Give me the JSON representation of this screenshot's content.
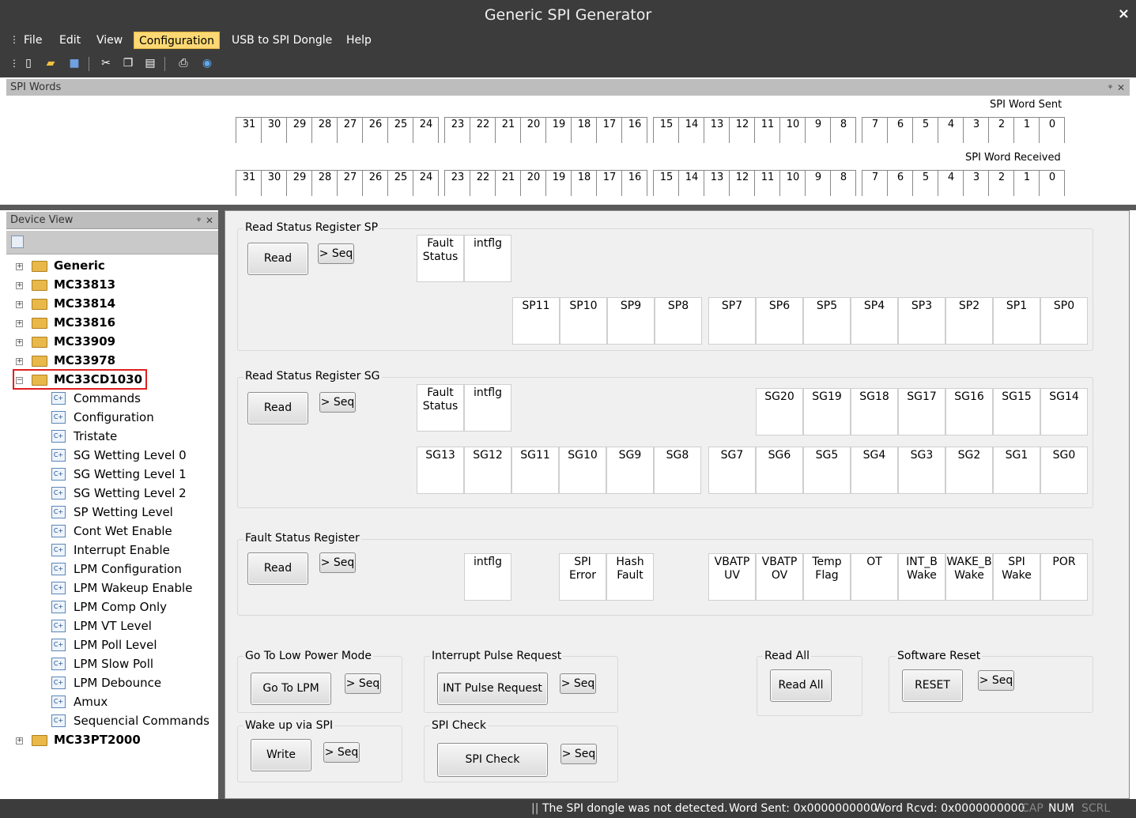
{
  "window": {
    "title": "Generic SPI Generator",
    "close_label": "×"
  },
  "menu": {
    "items": [
      "File",
      "Edit",
      "View",
      "Configuration",
      "USB to SPI Dongle",
      "Help"
    ],
    "active": "Configuration"
  },
  "toolbar": {
    "icons": [
      "new-icon",
      "open-icon",
      "save-icon",
      "cut-icon",
      "copy-icon",
      "paste-icon",
      "print-icon",
      "help-icon"
    ]
  },
  "spi_words": {
    "pane_title": "SPI Words",
    "sent_label": "SPI Word Sent",
    "received_label": "SPI Word Received",
    "bits": [
      "31",
      "30",
      "29",
      "28",
      "27",
      "26",
      "25",
      "24",
      "23",
      "22",
      "21",
      "20",
      "19",
      "18",
      "17",
      "16",
      "15",
      "14",
      "13",
      "12",
      "11",
      "10",
      "9",
      "8",
      "7",
      "6",
      "5",
      "4",
      "3",
      "2",
      "1",
      "0"
    ]
  },
  "device_view": {
    "pane_title": "Device View",
    "tree": [
      {
        "label": "Generic",
        "type": "folder",
        "expanded": false
      },
      {
        "label": "MC33813",
        "type": "folder",
        "expanded": false
      },
      {
        "label": "MC33814",
        "type": "folder",
        "expanded": false
      },
      {
        "label": "MC33816",
        "type": "folder",
        "expanded": false
      },
      {
        "label": "MC33909",
        "type": "folder",
        "expanded": false
      },
      {
        "label": "MC33978",
        "type": "folder",
        "expanded": false
      },
      {
        "label": "MC33CD1030",
        "type": "folder",
        "expanded": true,
        "highlighted": true
      },
      {
        "label": "Commands",
        "type": "leaf"
      },
      {
        "label": "Configuration",
        "type": "leaf"
      },
      {
        "label": "Tristate",
        "type": "leaf"
      },
      {
        "label": "SG Wetting Level 0",
        "type": "leaf"
      },
      {
        "label": "SG Wetting Level 1",
        "type": "leaf"
      },
      {
        "label": "SG Wetting Level 2",
        "type": "leaf"
      },
      {
        "label": "SP Wetting Level",
        "type": "leaf"
      },
      {
        "label": "Cont Wet Enable",
        "type": "leaf"
      },
      {
        "label": "Interrupt Enable",
        "type": "leaf"
      },
      {
        "label": "LPM Configuration",
        "type": "leaf"
      },
      {
        "label": "LPM Wakeup Enable",
        "type": "leaf"
      },
      {
        "label": "LPM Comp Only",
        "type": "leaf"
      },
      {
        "label": "LPM VT Level",
        "type": "leaf"
      },
      {
        "label": "LPM Poll Level",
        "type": "leaf"
      },
      {
        "label": "LPM Slow Poll",
        "type": "leaf"
      },
      {
        "label": "LPM Debounce",
        "type": "leaf"
      },
      {
        "label": "Amux",
        "type": "leaf"
      },
      {
        "label": "Sequencial Commands",
        "type": "leaf"
      },
      {
        "label": "MC33PT2000",
        "type": "folder",
        "expanded": false
      }
    ]
  },
  "main": {
    "seq_label": "> Seq",
    "read_label": "Read",
    "sp_group": {
      "title": "Read Status Register SP",
      "top_cells": [
        "Fault\nStatus",
        "intflg"
      ],
      "cells": [
        "SP11",
        "SP10",
        "SP9",
        "SP8",
        "SP7",
        "SP6",
        "SP5",
        "SP4",
        "SP3",
        "SP2",
        "SP1",
        "SP0"
      ]
    },
    "sg_group": {
      "title": "Read Status Register SG",
      "top_cells": [
        "Fault\nStatus",
        "intflg"
      ],
      "cells_row1": [
        "SG20",
        "SG19",
        "SG18",
        "SG17",
        "SG16",
        "SG15",
        "SG14"
      ],
      "cells_row2": [
        "SG13",
        "SG12",
        "SG11",
        "SG10",
        "SG9",
        "SG8",
        "SG7",
        "SG6",
        "SG5",
        "SG4",
        "SG3",
        "SG2",
        "SG1",
        "SG0"
      ]
    },
    "fault_group": {
      "title": "Fault Status Register",
      "cells": [
        "intflg",
        "SPI\nError",
        "Hash\nFault",
        "VBATP\nUV",
        "VBATP\nOV",
        "Temp\nFlag",
        "OT",
        "INT_B\nWake",
        "WAKE_B\nWake",
        "SPI\nWake",
        "POR"
      ]
    },
    "lpm_group": {
      "title": "Go To Low Power Mode",
      "button": "Go To LPM"
    },
    "int_group": {
      "title": "Interrupt Pulse Request",
      "button": "INT Pulse Request"
    },
    "readall_group": {
      "title": "Read All",
      "button": "Read All"
    },
    "reset_group": {
      "title": "Software Reset",
      "button": "RESET"
    },
    "wake_group": {
      "title": "Wake up via SPI",
      "button": "Write"
    },
    "spicheck_group": {
      "title": "SPI Check",
      "button": "SPI Check"
    }
  },
  "status": {
    "message": "The SPI dongle was not detected.",
    "word_sent": "Word Sent: 0x0000000000",
    "word_rcvd": "Word Rcvd: 0x0000000000",
    "cap": "CAP",
    "num": "NUM",
    "scrl": "SCRL"
  }
}
